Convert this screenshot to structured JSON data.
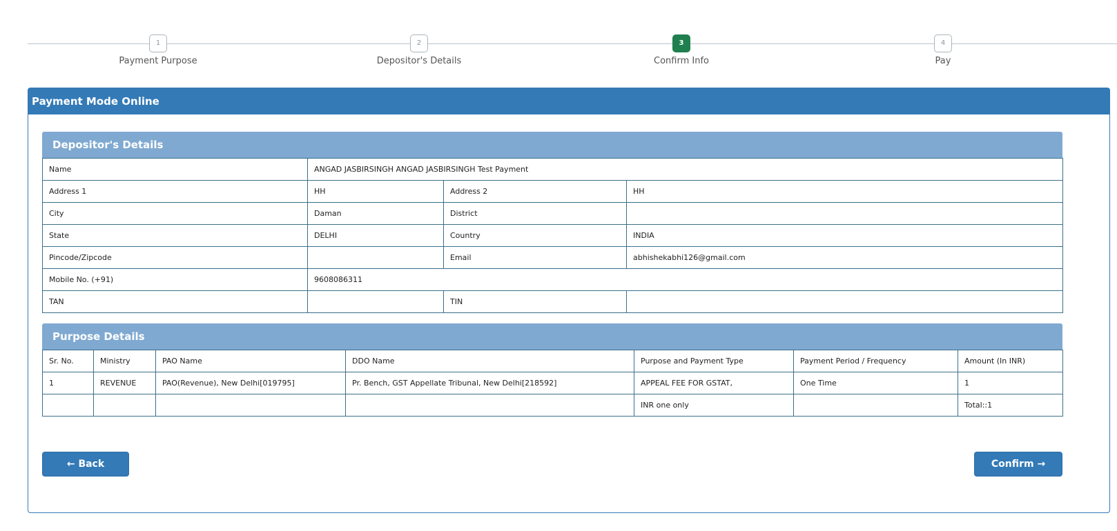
{
  "steps": [
    {
      "num": "1",
      "label": "Payment Purpose"
    },
    {
      "num": "2",
      "label": "Depositor's Details"
    },
    {
      "num": "3",
      "label": "Confirm Info"
    },
    {
      "num": "4",
      "label": "Pay"
    }
  ],
  "active_step": "3",
  "panel_title": "Payment Mode Online",
  "depositor": {
    "heading": "Depositor's Details",
    "name_label": "Name",
    "name_value": "ANGAD JASBIRSINGH ANGAD JASBIRSINGH Test Payment",
    "address1_label": "Address 1",
    "address1_value": "HH",
    "address2_label": "Address 2",
    "address2_value": "HH",
    "city_label": "City",
    "city_value": "Daman",
    "district_label": "District",
    "district_value": "",
    "state_label": "State",
    "state_value": "DELHI",
    "country_label": "Country",
    "country_value": "INDIA",
    "pincode_label": "Pincode/Zipcode",
    "pincode_value": "",
    "email_label": "Email",
    "email_value": "abhishekabhi126@gmail.com",
    "mobile_label": "Mobile No. (+91)",
    "mobile_value": "9608086311",
    "tan_label": "TAN",
    "tan_value": "",
    "tin_label": "TIN",
    "tin_value": ""
  },
  "purpose": {
    "heading": "Purpose Details",
    "columns": [
      "Sr. No.",
      "Ministry",
      "PAO Name",
      "DDO Name",
      "Purpose and Payment Type",
      "Payment Period / Frequency",
      "Amount (In INR)"
    ],
    "row": [
      "1",
      "REVENUE",
      "PAO(Revenue), New Delhi[019795]",
      "Pr. Bench, GST Appellate Tribunal, New Delhi[218592]",
      "APPEAL FEE FOR GSTAT,",
      "One Time",
      "1"
    ],
    "amount_words": "INR one only",
    "total": "Total::1"
  },
  "buttons": {
    "back": "Back",
    "confirm": "Confirm"
  },
  "icons": {
    "back": "arrow-left-icon",
    "confirm": "arrow-right-icon"
  },
  "colors": {
    "primary": "#337ab7",
    "subheading": "#7fa9d1",
    "active_step": "#1f7f4e"
  }
}
